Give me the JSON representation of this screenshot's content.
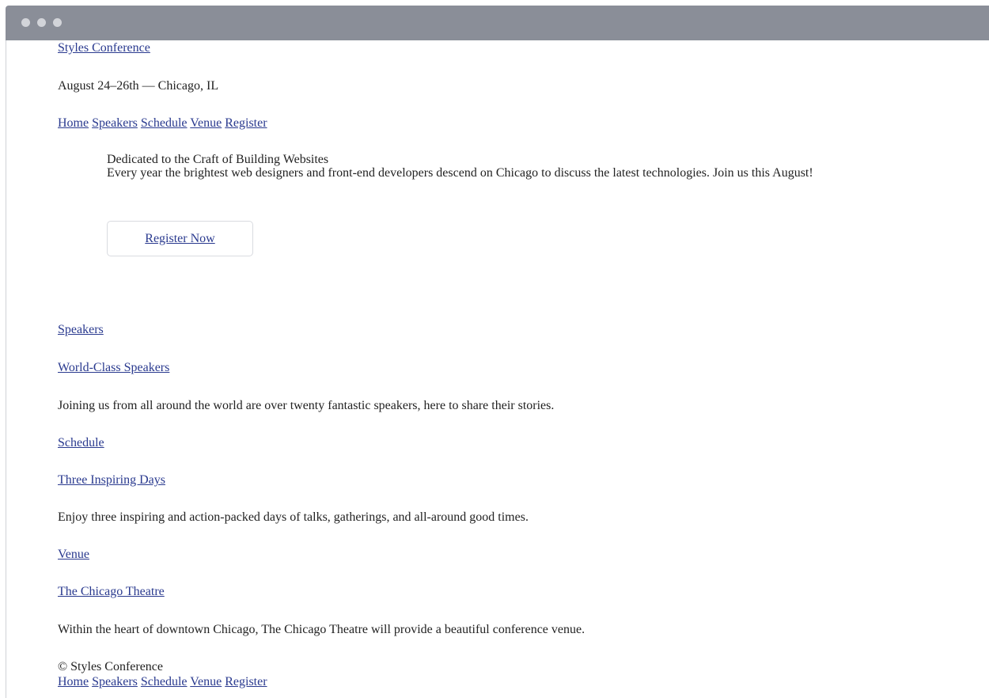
{
  "header": {
    "logo": "Styles Conference",
    "dates": "August 24–26th — Chicago, IL",
    "nav": [
      "Home",
      "Speakers",
      "Schedule",
      "Venue",
      "Register"
    ]
  },
  "hero": {
    "tagline": "Dedicated to the Craft of Building Websites",
    "description": "Every year the brightest web designers and front-end developers descend on Chicago to discuss the latest technologies. Join us this August!",
    "cta": "Register Now"
  },
  "sections": [
    {
      "link": "Speakers",
      "heading": "World-Class Speakers",
      "text": "Joining us from all around the world are over twenty fantastic speakers, here to share their stories."
    },
    {
      "link": "Schedule",
      "heading": "Three Inspiring Days",
      "text": "Enjoy three inspiring and action-packed days of talks, gatherings, and all-around good times."
    },
    {
      "link": "Venue",
      "heading": "The Chicago Theatre",
      "text": "Within the heart of downtown Chicago, The Chicago Theatre will provide a beautiful conference venue."
    }
  ],
  "footer": {
    "copyright": "© Styles Conference",
    "nav": [
      "Home",
      "Speakers",
      "Schedule",
      "Venue",
      "Register"
    ]
  },
  "colors": {
    "link": "#2a3a8f",
    "titlebar": "#8a8e98"
  }
}
